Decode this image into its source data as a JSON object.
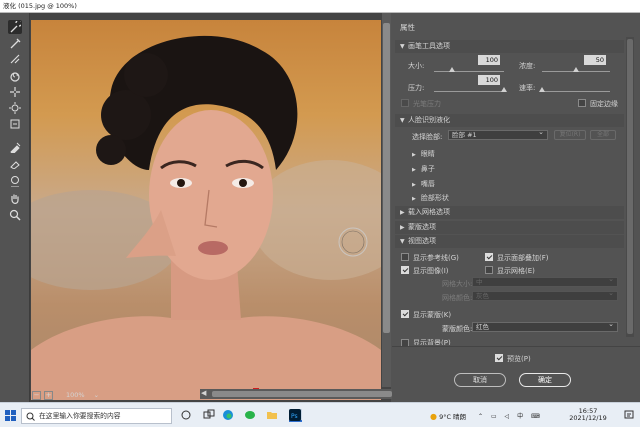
{
  "window": {
    "title": "液化 (015.jpg @ 100%)"
  },
  "tools": [
    "warp-icon",
    "reconstruct-icon",
    "smooth-icon",
    "twirl-icon",
    "pucker-icon",
    "bloat-icon",
    "push-left-icon",
    "freeze-mask-icon",
    "thaw-mask-icon",
    "face-tool-icon",
    "hand-icon",
    "zoom-icon"
  ],
  "canvas": {
    "zoom": "100%"
  },
  "properties": {
    "title": "属性",
    "brush": {
      "header": "画笔工具选项",
      "size_label": "大小:",
      "size": "100",
      "density_label": "浓度:",
      "density": "50",
      "pressure_label": "压力:",
      "pressure": "100",
      "rate_label": "速率:",
      "rate": "0",
      "stylus_label": "光笔压力",
      "pin_edges_label": "固定边缘",
      "size_level": 0.25,
      "density_level": 0.5,
      "pressure_level": 1.0,
      "rate_level": 0.0
    },
    "face": {
      "header": "人脸识别液化",
      "select_label": "选择脸部:",
      "select_value": "脸部 #1",
      "reset": "复位(R)",
      "all": "全部",
      "items": [
        "眼睛",
        "鼻子",
        "嘴唇",
        "脸部形状"
      ]
    },
    "load_mesh": {
      "header": "载入网格选项"
    },
    "mask": {
      "header": "蒙版选项"
    },
    "view": {
      "header": "视图选项",
      "show_guides": "显示参考线(G)",
      "show_face_overlay": "显示面部叠加(F)",
      "show_image": "显示图像(I)",
      "show_mesh": "显示网格(E)",
      "mesh_size_label": "网格大小:",
      "mesh_size_value": "中",
      "mesh_color_label": "网格颜色:",
      "mesh_color_value": "灰色",
      "show_mask": "显示蒙版(K)",
      "mask_color_label": "蒙版颜色:",
      "mask_color_value": "红色",
      "show_backdrop": "显示背景(P)"
    },
    "preview": "预览(P)",
    "cancel": "取消",
    "ok": "确定"
  },
  "taskbar": {
    "search_placeholder": "在这里输入你要搜索的内容",
    "weather": "9°C 晴朗",
    "time": "16:57",
    "date": "2021/12/19"
  },
  "colors": {
    "panel": "#535353",
    "canvas_bg": "#444444",
    "taskbar": "#e8eef5"
  }
}
